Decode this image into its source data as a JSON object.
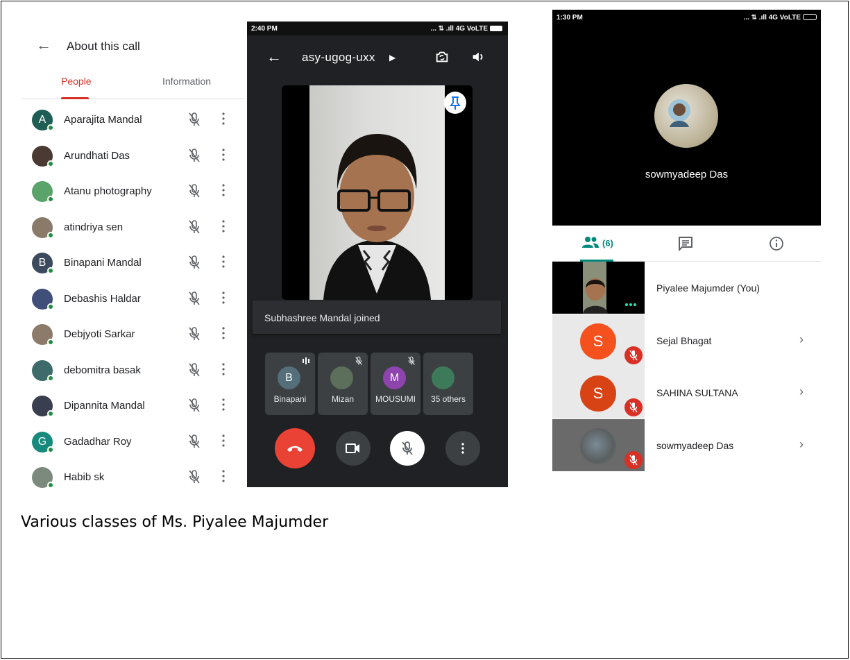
{
  "about_panel": {
    "title": "About this call",
    "tabs": [
      "People",
      "Information"
    ],
    "people": [
      {
        "name": "Aparajita Mandal",
        "initial": "A",
        "color": "#1e5e54"
      },
      {
        "name": "Arundhati Das",
        "initial": "",
        "color": "#4a3a33"
      },
      {
        "name": "Atanu photography",
        "initial": "",
        "color": "#5aa36b"
      },
      {
        "name": "atindriya sen",
        "initial": "",
        "color": "#8a7a6a"
      },
      {
        "name": "Binapani Mandal",
        "initial": "B",
        "color": "#3b4a5c"
      },
      {
        "name": "Debashis Haldar",
        "initial": "",
        "color": "#3f4f7a"
      },
      {
        "name": "Debjyoti Sarkar",
        "initial": "",
        "color": "#8c7b6b"
      },
      {
        "name": "debomitra basak",
        "initial": "",
        "color": "#3c6b6a"
      },
      {
        "name": "Dipannita Mandal",
        "initial": "",
        "color": "#3a3f4f"
      },
      {
        "name": "Gadadhar Roy",
        "initial": "G",
        "color": "#168b7d"
      },
      {
        "name": "Habib sk",
        "initial": "",
        "color": "#7b8a7c"
      }
    ]
  },
  "meet_call": {
    "status_time": "2:40 PM",
    "status_signal": "... ⇅ .ıll 4G VoLTE",
    "meeting_code": "asy-ugog-uxx",
    "toast": "Subhashree Mandal joined",
    "tiles": [
      {
        "label": "Binapani",
        "initial": "B",
        "color": "#546e7a"
      },
      {
        "label": "Mizan",
        "initial": "",
        "color": "#5b6f5a"
      },
      {
        "label": "MOUSUMI",
        "initial": "M",
        "color": "#8e44ad"
      },
      {
        "label": "35 others",
        "initial": "",
        "color": "#3d7a5a"
      }
    ]
  },
  "participants_panel": {
    "status_time": "1:30 PM",
    "status_signal": "... ⇅ .ıll 4G VoLTE",
    "featured_name": "sowmyadeep Das",
    "people_count": "(6)",
    "rows": [
      {
        "name": "Piyalee Majumder (You)",
        "initial": "",
        "color": ""
      },
      {
        "name": "Sejal Bhagat",
        "initial": "S",
        "color": "#f4511e"
      },
      {
        "name": "SAHINA SULTANA",
        "initial": "S",
        "color": "#d84315"
      },
      {
        "name": "sowmyadeep Das",
        "initial": "",
        "color": ""
      }
    ]
  },
  "caption": "Various classes of Ms. Piyalee Majumder"
}
